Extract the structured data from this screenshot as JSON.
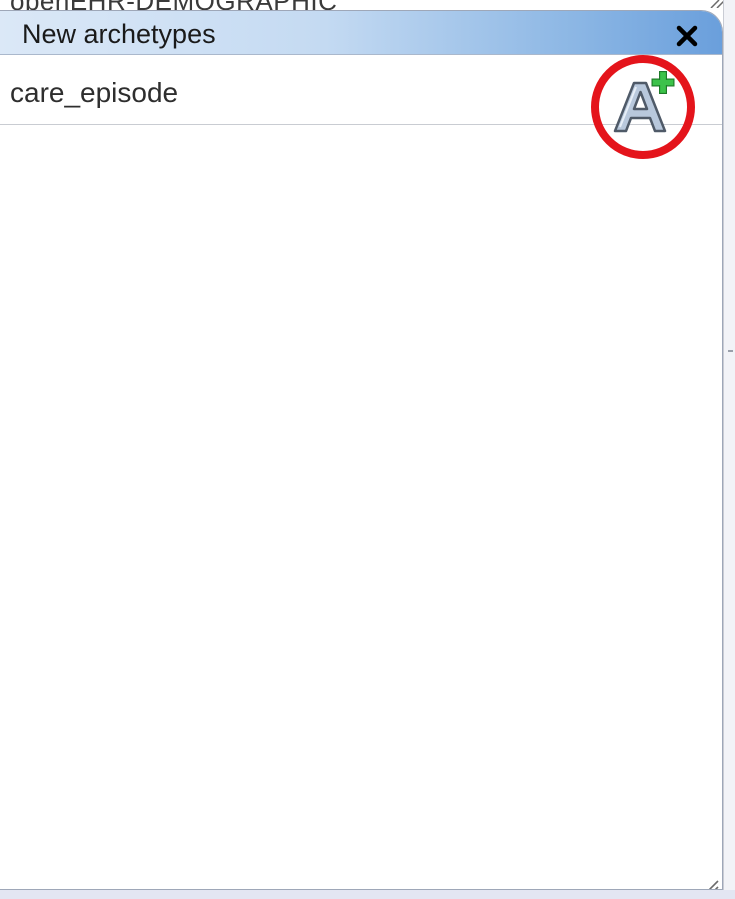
{
  "background_window": {
    "clipped_title": "openEHR-DEMOGRAPHIC"
  },
  "panel": {
    "title": "New archetypes",
    "close_label": "×",
    "items": [
      {
        "label": "care_episode",
        "action_icon": "add-archetype-icon"
      }
    ]
  },
  "colors": {
    "titlebar_gradient_start": "#dbe8f7",
    "titlebar_gradient_end": "#6a9fdc",
    "highlight_ring": "#e4141b",
    "plus_green": "#2fae3b",
    "archetype_letter": "#b8c8dc"
  }
}
